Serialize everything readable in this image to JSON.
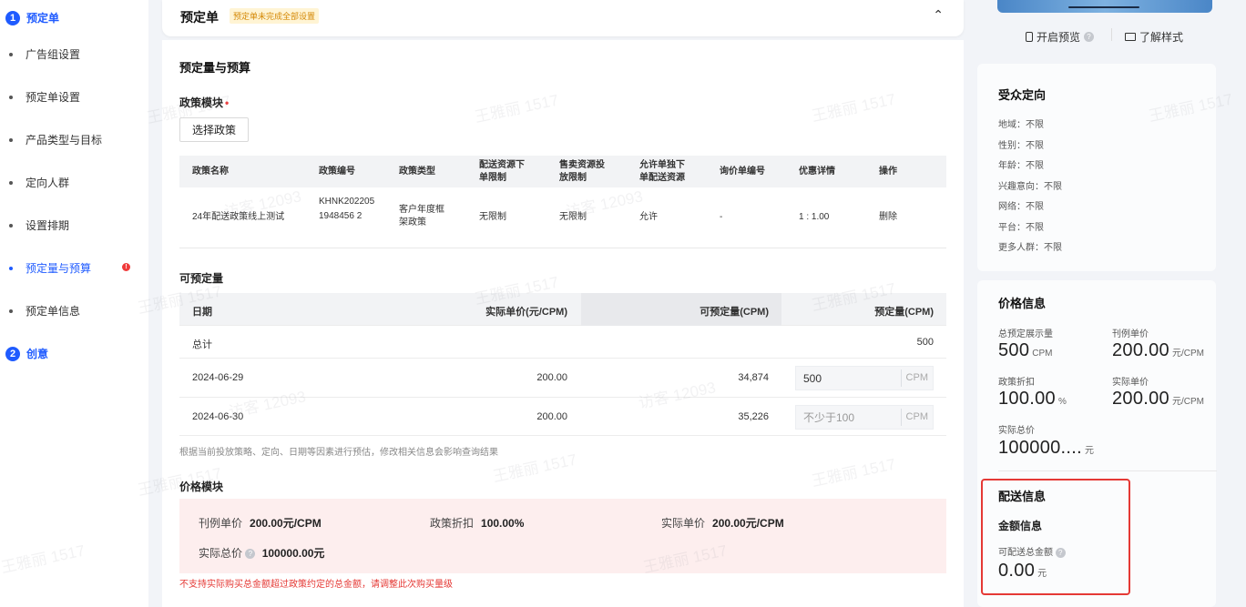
{
  "sidebar": {
    "steps": [
      {
        "num": "1",
        "label": "预定单"
      },
      {
        "num": "2",
        "label": "创意"
      }
    ],
    "items": [
      {
        "label": "广告组设置"
      },
      {
        "label": "预定单设置"
      },
      {
        "label": "产品类型与目标"
      },
      {
        "label": "定向人群"
      },
      {
        "label": "设置排期"
      },
      {
        "label": "预定量与预算",
        "alert": "!"
      },
      {
        "label": "预定单信息"
      }
    ]
  },
  "header": {
    "title": "预定单",
    "warning": "预定单未完成全部设置",
    "collapse_icon": "⌃"
  },
  "section": {
    "title": "预定量与预算"
  },
  "policy": {
    "title": "政策模块",
    "required_mark": "•",
    "select_button": "选择政策",
    "columns": [
      "政策名称",
      "政策编号",
      "政策类型",
      "配送资源下单限制",
      "售卖资源投放限制",
      "允许单独下单配送资源",
      "询价单编号",
      "优惠详情",
      "操作"
    ],
    "row": {
      "name": "24年配送政策线上测试",
      "code": "KHNK2022051948456 2",
      "type": "客户年度框架政策",
      "delivery_limit": "无限制",
      "sale_limit": "无限制",
      "allow_separate": "允许",
      "inquiry_no": "-",
      "discount": "1 : 1.00",
      "action": "删除"
    }
  },
  "quantity": {
    "title": "可预定量",
    "columns": [
      "日期",
      "实际单价(元/CPM)",
      "可预定量(CPM)",
      "预定量(CPM)"
    ],
    "total_label": "总计",
    "total_value": "500",
    "rows": [
      {
        "date": "2024-06-29",
        "price": "200.00",
        "available": "34,874",
        "input_value": "500",
        "input_placeholder": "",
        "unit": "CPM"
      },
      {
        "date": "2024-06-30",
        "price": "200.00",
        "available": "35,226",
        "input_value": "",
        "input_placeholder": "不少于100",
        "unit": "CPM"
      }
    ],
    "note": "根据当前投放策略、定向、日期等因素进行预估，修改相关信息会影响查询结果"
  },
  "price_module": {
    "title": "价格模块",
    "list_price_label": "刊例单价",
    "list_price_value": "200.00元/CPM",
    "policy_discount_label": "政策折扣",
    "policy_discount_value": "100.00%",
    "actual_price_label": "实际单价",
    "actual_price_value": "200.00元/CPM",
    "total_label": "实际总价",
    "total_value": "100000.00元",
    "help_icon": "?",
    "error": "不支持实际购买总金额超过政策约定的总金额，请调整此次购买量级"
  },
  "right": {
    "preview_link": "开启预览",
    "style_link": "了解样式",
    "audience": {
      "title": "受众定向",
      "items": [
        "地域：不限",
        "性别：不限",
        "年龄：不限",
        "兴趣意向：不限",
        "网络：不限",
        "平台：不限",
        "更多人群：不限"
      ]
    },
    "price_info": {
      "title": "价格信息",
      "total_impressions_label": "总预定展示量",
      "total_impressions_value": "500",
      "total_impressions_unit": "CPM",
      "list_price_label": "刊例单价",
      "list_price_value": "200.00",
      "list_price_unit": "元/CPM",
      "discount_label": "政策折扣",
      "discount_value": "100.00",
      "discount_unit": "%",
      "actual_price_label": "实际单价",
      "actual_price_value": "200.00",
      "actual_price_unit": "元/CPM",
      "total_label": "实际总价",
      "total_value": "100000....",
      "total_unit": "元"
    },
    "delivery": {
      "title": "配送信息",
      "sub_title": "金额信息",
      "amount_label": "可配送总金额",
      "amount_value": "0.00",
      "amount_unit": "元"
    }
  },
  "watermarks": [
    "王雅丽 1517",
    "访客 12093"
  ],
  "colors": {
    "accent": "#1f5bff",
    "error": "#e53935",
    "warning_bg": "#fff4d4",
    "price_box_bg": "#fdeeee"
  }
}
